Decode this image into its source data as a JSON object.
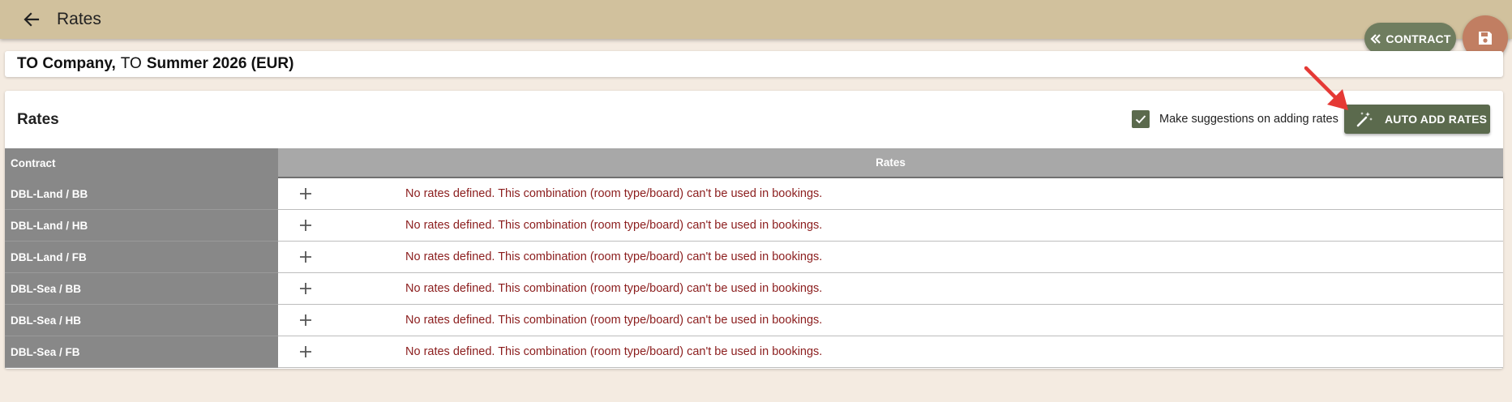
{
  "topbar": {
    "title": "Rates"
  },
  "actions": {
    "contract_label": "CONTRACT"
  },
  "contract_header": {
    "part1": "TO Company,",
    "part2": "TO",
    "part3": "Summer 2026 (EUR)"
  },
  "panel": {
    "title": "Rates",
    "suggest_label": "Make suggestions on adding rates",
    "suggest_checked": true,
    "auto_add_label": "AUTO ADD RATES"
  },
  "grid": {
    "columns": [
      "Contract",
      "Rates"
    ],
    "rows": [
      {
        "contract": "DBL-Land / BB",
        "message": "No rates defined. This combination (room type/board) can't be used in bookings."
      },
      {
        "contract": "DBL-Land / HB",
        "message": "No rates defined. This combination (room type/board) can't be used in bookings."
      },
      {
        "contract": "DBL-Land / FB",
        "message": "No rates defined. This combination (room type/board) can't be used in bookings."
      },
      {
        "contract": "DBL-Sea / BB",
        "message": "No rates defined. This combination (room type/board) can't be used in bookings."
      },
      {
        "contract": "DBL-Sea / HB",
        "message": "No rates defined. This combination (room type/board) can't be used in bookings."
      },
      {
        "contract": "DBL-Sea / FB",
        "message": "No rates defined. This combination (room type/board) can't be used in bookings."
      }
    ]
  },
  "colors": {
    "topbar": "#d1c19d",
    "primary": "#5b6a4d",
    "fab": "#c17e62",
    "error_text": "#8b1d1d",
    "annotation_arrow": "#e53935"
  },
  "icons": {
    "back": "arrow-left-icon",
    "contract": "chevron-double-left-icon",
    "save": "floppy-disk-icon",
    "checkbox": "check-icon",
    "auto_add": "magic-wand-icon",
    "add": "plus-icon"
  }
}
